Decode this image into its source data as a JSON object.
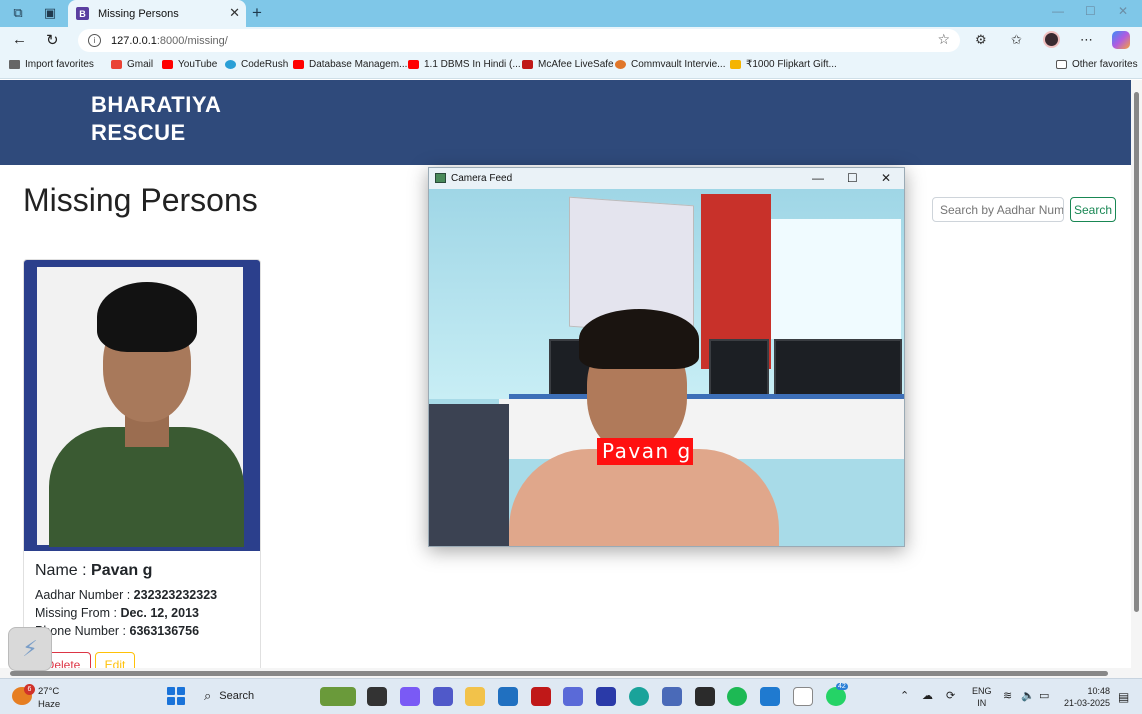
{
  "browser": {
    "tab_title": "Missing Persons",
    "tab_favicon_letter": "B",
    "url_host": "127.0.0.1",
    "url_path": ":8000/missing/",
    "bookmarks": [
      "Import favorites",
      "Gmail",
      "YouTube",
      "CodeRush",
      "Database Managem...",
      "1.1 DBMS In Hindi (...",
      "McAfee LiveSafe",
      "Commvault Intervie...",
      "₹1000 Flipkart Gift..."
    ],
    "other_favorites": "Other favorites"
  },
  "site": {
    "brand_line1": "BHARATIYA",
    "brand_line2": "RESCUE",
    "page_title": "Missing Persons",
    "search_placeholder": "Search by Aadhar Number",
    "search_button": "Search"
  },
  "card": {
    "name_label": "Name : ",
    "name_value": "Pavan g",
    "aadhar_label": "Aadhar Number : ",
    "aadhar_value": "232323232323",
    "missing_label": "Missing From : ",
    "missing_value": "Dec. 12, 2013",
    "phone_label": "Phone Number : ",
    "phone_value": "6363136756",
    "delete_button": "Delete",
    "edit_button": "Edit"
  },
  "camera_window": {
    "title": "Camera Feed",
    "detected_label": "Pavan g"
  },
  "taskbar": {
    "weather_temp": "27°C",
    "weather_cond": "Haze",
    "weather_badge": "6",
    "search_label": "Search",
    "lang_line1": "ENG",
    "lang_line2": "IN",
    "time": "10:48",
    "date": "21-03-2025",
    "whatsapp_badge": "42"
  },
  "colors": {
    "navbar": "#2f4a7b",
    "titlebar": "#7fc7e8",
    "delete": "#dc3545",
    "edit": "#ffc107",
    "search": "#198754"
  }
}
